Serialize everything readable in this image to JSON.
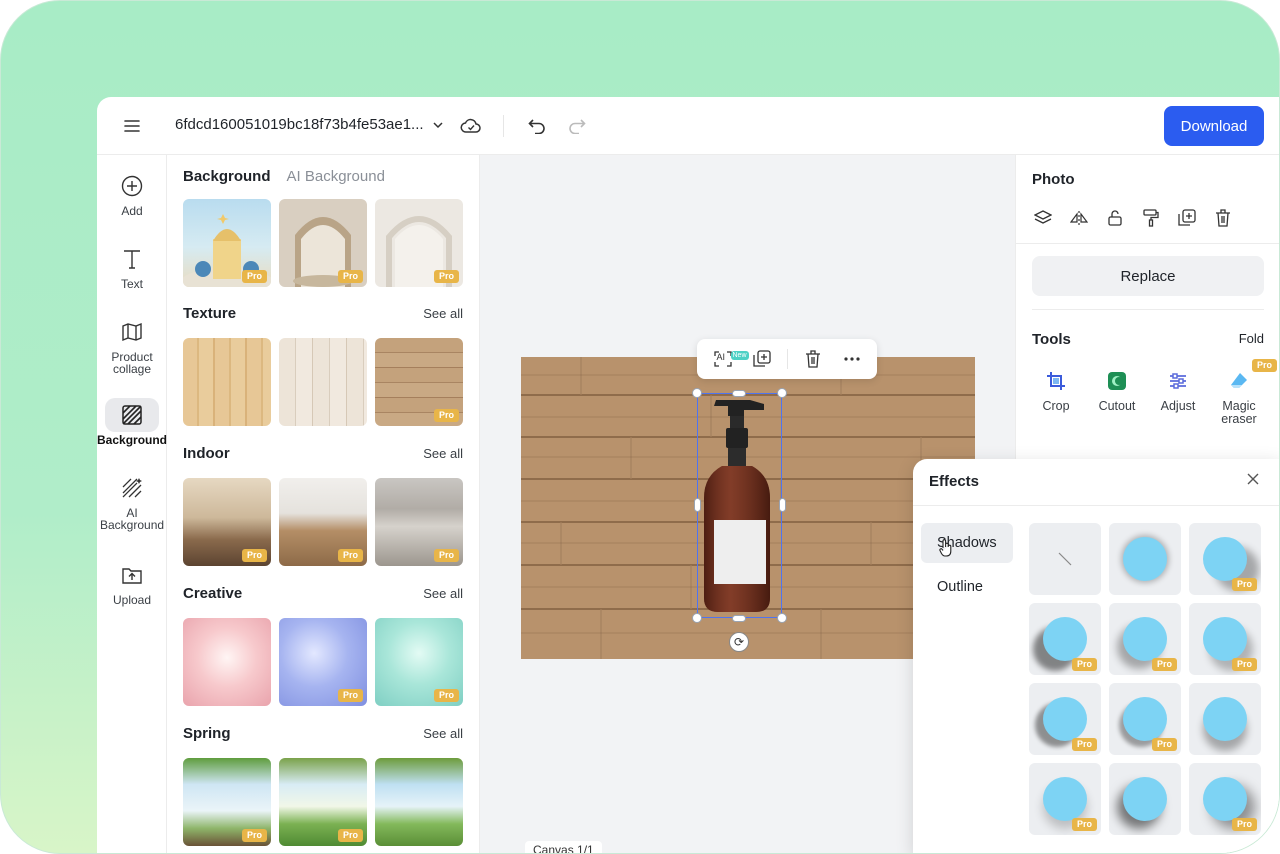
{
  "header": {
    "file_name": "6fdcd160051019bc18f73b4fe53ae1...",
    "download_label": "Download"
  },
  "rail": [
    {
      "label": "Add",
      "icon": "plus-circle-icon"
    },
    {
      "label": "Text",
      "icon": "text-icon"
    },
    {
      "label": "Product collage",
      "icon": "collage-icon"
    },
    {
      "label": "Background",
      "icon": "background-icon",
      "active": true
    },
    {
      "label": "AI Background",
      "icon": "ai-background-icon"
    },
    {
      "label": "Upload",
      "icon": "upload-icon"
    }
  ],
  "panel": {
    "tabs": [
      "Background",
      "AI Background"
    ],
    "sections": [
      {
        "title": "Texture",
        "see_all": "See all"
      },
      {
        "title": "Indoor",
        "see_all": "See all"
      },
      {
        "title": "Creative",
        "see_all": "See all"
      },
      {
        "title": "Spring",
        "see_all": "See all"
      }
    ],
    "pro_label": "Pro"
  },
  "canvas": {
    "new_tag": "New",
    "ai_label": "AI",
    "canvas_label": "Canvas 1/1"
  },
  "right_panel": {
    "title": "Photo",
    "replace_label": "Replace",
    "tools_title": "Tools",
    "fold_label": "Fold",
    "tools": [
      {
        "label": "Crop",
        "icon": "crop-icon"
      },
      {
        "label": "Cutout",
        "icon": "cutout-icon"
      },
      {
        "label": "Adjust",
        "icon": "adjust-icon"
      },
      {
        "label": "Magic eraser",
        "icon": "magic-eraser-icon",
        "pro": true
      }
    ]
  },
  "effects": {
    "title": "Effects",
    "tabs": [
      "Shadows",
      "Outline"
    ],
    "active_tab": "Shadows"
  },
  "colors": {
    "accent": "#2b5cf0",
    "pro_badge": "#e8b548",
    "shadow_ball": "#7dd3f4"
  }
}
